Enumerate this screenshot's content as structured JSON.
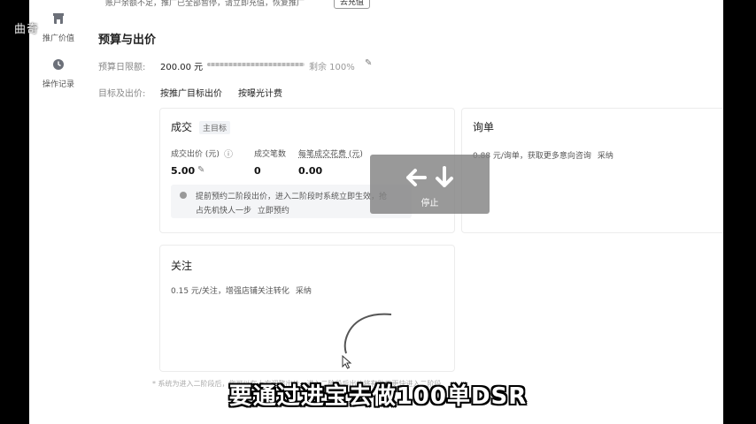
{
  "watermark": "曲奇",
  "nav": {
    "items": [
      {
        "label": "推广价值",
        "icon": "store-icon"
      },
      {
        "label": "操作记录",
        "icon": "clock-icon"
      }
    ]
  },
  "notice": {
    "text": "账户余额不足，推广已全部暂停，请立即充值，恢复推广",
    "button": "去充值"
  },
  "section": {
    "title": "预算与出价",
    "budget_label": "预算日限额:",
    "budget_value": "200.00 元",
    "remaining": "剩余 100%",
    "bid_label": "目标及出价:",
    "bid_options": [
      "按推广目标出价",
      "按曝光计费"
    ]
  },
  "cards": {
    "deal": {
      "title": "成交",
      "tag": "主目标",
      "bid_label": "成交出价 (元)",
      "bid_value": "5.00",
      "count_label": "成交笔数",
      "count_value": "0",
      "cost_label": "每笔成交花费 (元)",
      "cost_value": "0.00",
      "tip_line1": "提前预约二阶段出价，进入二阶段时系统立即生效，抢",
      "tip_line2": "占先机快人一步",
      "tip_link": "立即预约"
    },
    "inquiry": {
      "title": "询单",
      "desc": "0.88 元/询单，获取更多意向咨询",
      "link": "采纳"
    },
    "follow": {
      "title": "关注",
      "desc": "0.15 元/关注，增强店铺关注转化",
      "link": "采纳"
    }
  },
  "footnote": "* 系统为进入二阶段后，您可以在上方调整出价，进入二阶段后出价将有助于更快进入二阶段",
  "overlay": {
    "stop_label": "停止",
    "icons": [
      "arrow-left-icon",
      "arrow-down-icon"
    ]
  },
  "subtitle": "要通过进宝去做100单DSR"
}
